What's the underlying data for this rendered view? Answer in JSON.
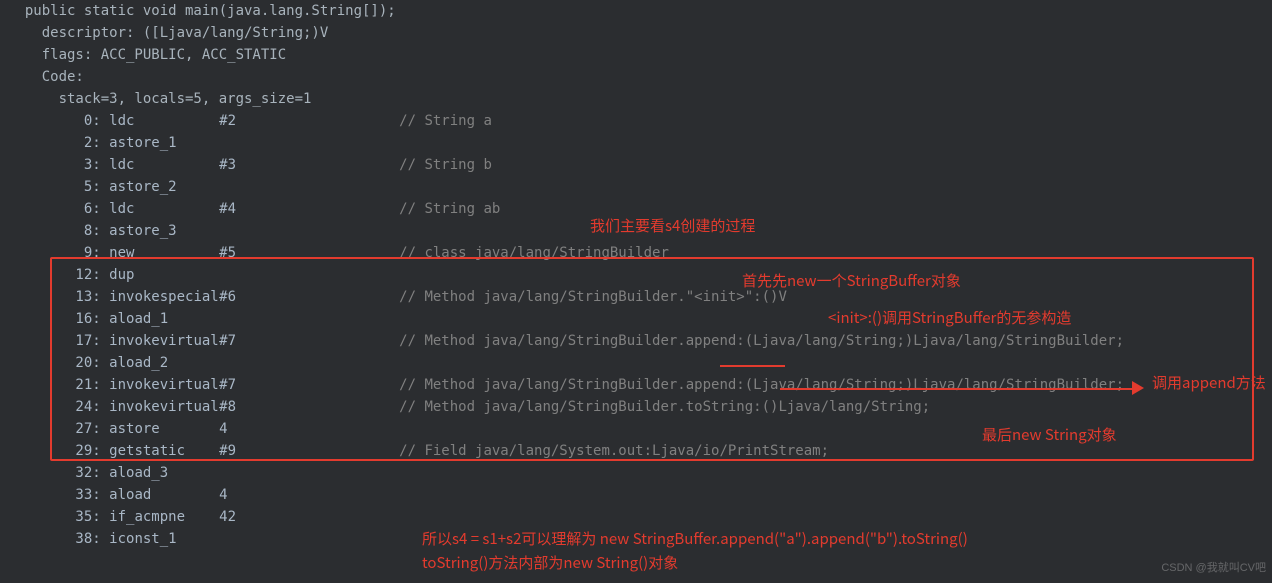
{
  "code": {
    "l01": "  public static void main(java.lang.String[]);",
    "l02": "    descriptor: ([Ljava/lang/String;)V",
    "l03": "    flags: ACC_PUBLIC, ACC_STATIC",
    "l04": "    Code:",
    "l05": "      stack=3, locals=5, args_size=1",
    "l06n": "         0:",
    "l06op": "ldc",
    "l06ref": "#2",
    "l06cmt": "// String a",
    "l07n": "         2:",
    "l07op": "astore_1",
    "l08n": "         3:",
    "l08op": "ldc",
    "l08ref": "#3",
    "l08cmt": "// String b",
    "l09n": "         5:",
    "l09op": "astore_2",
    "l10n": "         6:",
    "l10op": "ldc",
    "l10ref": "#4",
    "l10cmt": "// String ab",
    "l11n": "         8:",
    "l11op": "astore_3",
    "l12n": "         9:",
    "l12op": "new",
    "l12ref": "#5",
    "l12cmt": "// class java/lang/StringBuilder",
    "l13n": "        12:",
    "l13op": "dup",
    "l14n": "        13:",
    "l14op": "invokespecial",
    "l14ref": "#6",
    "l14cmt": "// Method java/lang/StringBuilder.\"<init>\":()V",
    "l15n": "        16:",
    "l15op": "aload_1",
    "l16n": "        17:",
    "l16op": "invokevirtual",
    "l16ref": "#7",
    "l16cmt": "// Method java/lang/StringBuilder.append:(Ljava/lang/String;)Ljava/lang/StringBuilder;",
    "l17n": "        20:",
    "l17op": "aload_2",
    "l18n": "        21:",
    "l18op": "invokevirtual",
    "l18ref": "#7",
    "l18cmt": "// Method java/lang/StringBuilder.append:(Ljava/lang/String;)Ljava/lang/StringBuilder;",
    "l19n": "        24:",
    "l19op": "invokevirtual",
    "l19ref": "#8",
    "l19cmt": "// Method java/lang/StringBuilder.toString:()Ljava/lang/String;",
    "l20n": "        27:",
    "l20op": "astore",
    "l20ref": "4",
    "l21n": "        29:",
    "l21op": "getstatic",
    "l21ref": "#9",
    "l21cmt": "// Field java/lang/System.out:Ljava/io/PrintStream;",
    "l22n": "        32:",
    "l22op": "aload_3",
    "l23n": "        33:",
    "l23op": "aload",
    "l23ref": "4",
    "l24n": "        35:",
    "l24op": "if_acmpne",
    "l24ref": "42",
    "l25n": "        38:",
    "l25op": "iconst_1"
  },
  "annotations": {
    "a1": "我们主要看s4创建的过程",
    "a2": "首先先new一个StringBuffer对象",
    "a3": "<init>:()调用StringBuffer的无参构造",
    "a4": "调用append方法",
    "a5": "最后new String对象",
    "a6": "所以s4 = s1+s2可以理解为 new StringBuffer.append(\"a\").append(\"b\").toString()",
    "a7": "toString()方法内部为new String()对象"
  },
  "watermark": "CSDN @我就叫CV吧"
}
